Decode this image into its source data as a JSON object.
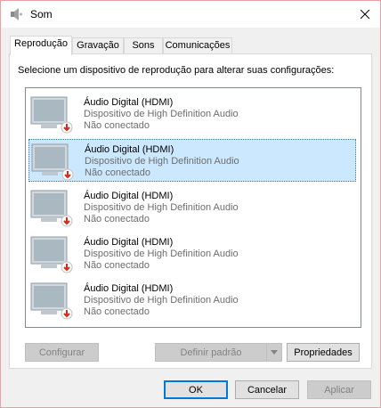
{
  "window": {
    "title": "Som",
    "title_icon": "speaker-icon",
    "close_icon": "close-icon"
  },
  "tabs": [
    {
      "label": "Reprodução",
      "active": true
    },
    {
      "label": "Gravação",
      "active": false
    },
    {
      "label": "Sons",
      "active": false
    },
    {
      "label": "Comunicações",
      "active": false
    }
  ],
  "panel": {
    "instruction": "Selecione um dispositivo de reprodução para alterar suas configurações:"
  },
  "devices": [
    {
      "name": "Áudio Digital (HDMI)",
      "description": "Dispositivo de High Definition Audio",
      "status": "Não conectado",
      "selected": false
    },
    {
      "name": "Áudio Digital (HDMI)",
      "description": "Dispositivo de High Definition Audio",
      "status": "Não conectado",
      "selected": true
    },
    {
      "name": "Áudio Digital (HDMI)",
      "description": "Dispositivo de High Definition Audio",
      "status": "Não conectado",
      "selected": false
    },
    {
      "name": "Áudio Digital (HDMI)",
      "description": "Dispositivo de High Definition Audio",
      "status": "Não conectado",
      "selected": false
    },
    {
      "name": "Áudio Digital (HDMI)",
      "description": "Dispositivo de High Definition Audio",
      "status": "Não conectado",
      "selected": false
    }
  ],
  "panel_buttons": {
    "configure": "Configurar",
    "set_default": "Definir padrão",
    "properties": "Propriedades"
  },
  "dialog_buttons": {
    "ok": "OK",
    "cancel": "Cancelar",
    "apply": "Aplicar"
  },
  "colors": {
    "selection": "#cce8ff",
    "default_button_border": "#0078d7",
    "disabled_status": "#ff0000"
  }
}
